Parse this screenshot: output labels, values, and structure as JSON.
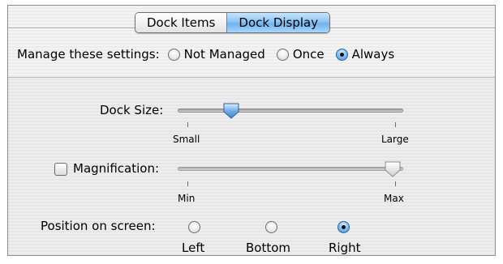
{
  "tabs": [
    {
      "label": "Dock Items",
      "selected": false
    },
    {
      "label": "Dock Display",
      "selected": true
    }
  ],
  "manage": {
    "label": "Manage these settings:",
    "options": [
      "Not Managed",
      "Once",
      "Always"
    ],
    "selected": "Always"
  },
  "dock_size": {
    "label": "Dock Size:",
    "min_label": "Small",
    "max_label": "Large",
    "value_fraction": 0.21
  },
  "magnification": {
    "label": "Magnification:",
    "checked": false,
    "min_label": "Min",
    "max_label": "Max",
    "value_fraction": 1.0
  },
  "position": {
    "label": "Position on screen:",
    "options": [
      "Left",
      "Bottom",
      "Right"
    ],
    "selected": "Right"
  },
  "colors": {
    "accent": "#6fb2ee"
  }
}
